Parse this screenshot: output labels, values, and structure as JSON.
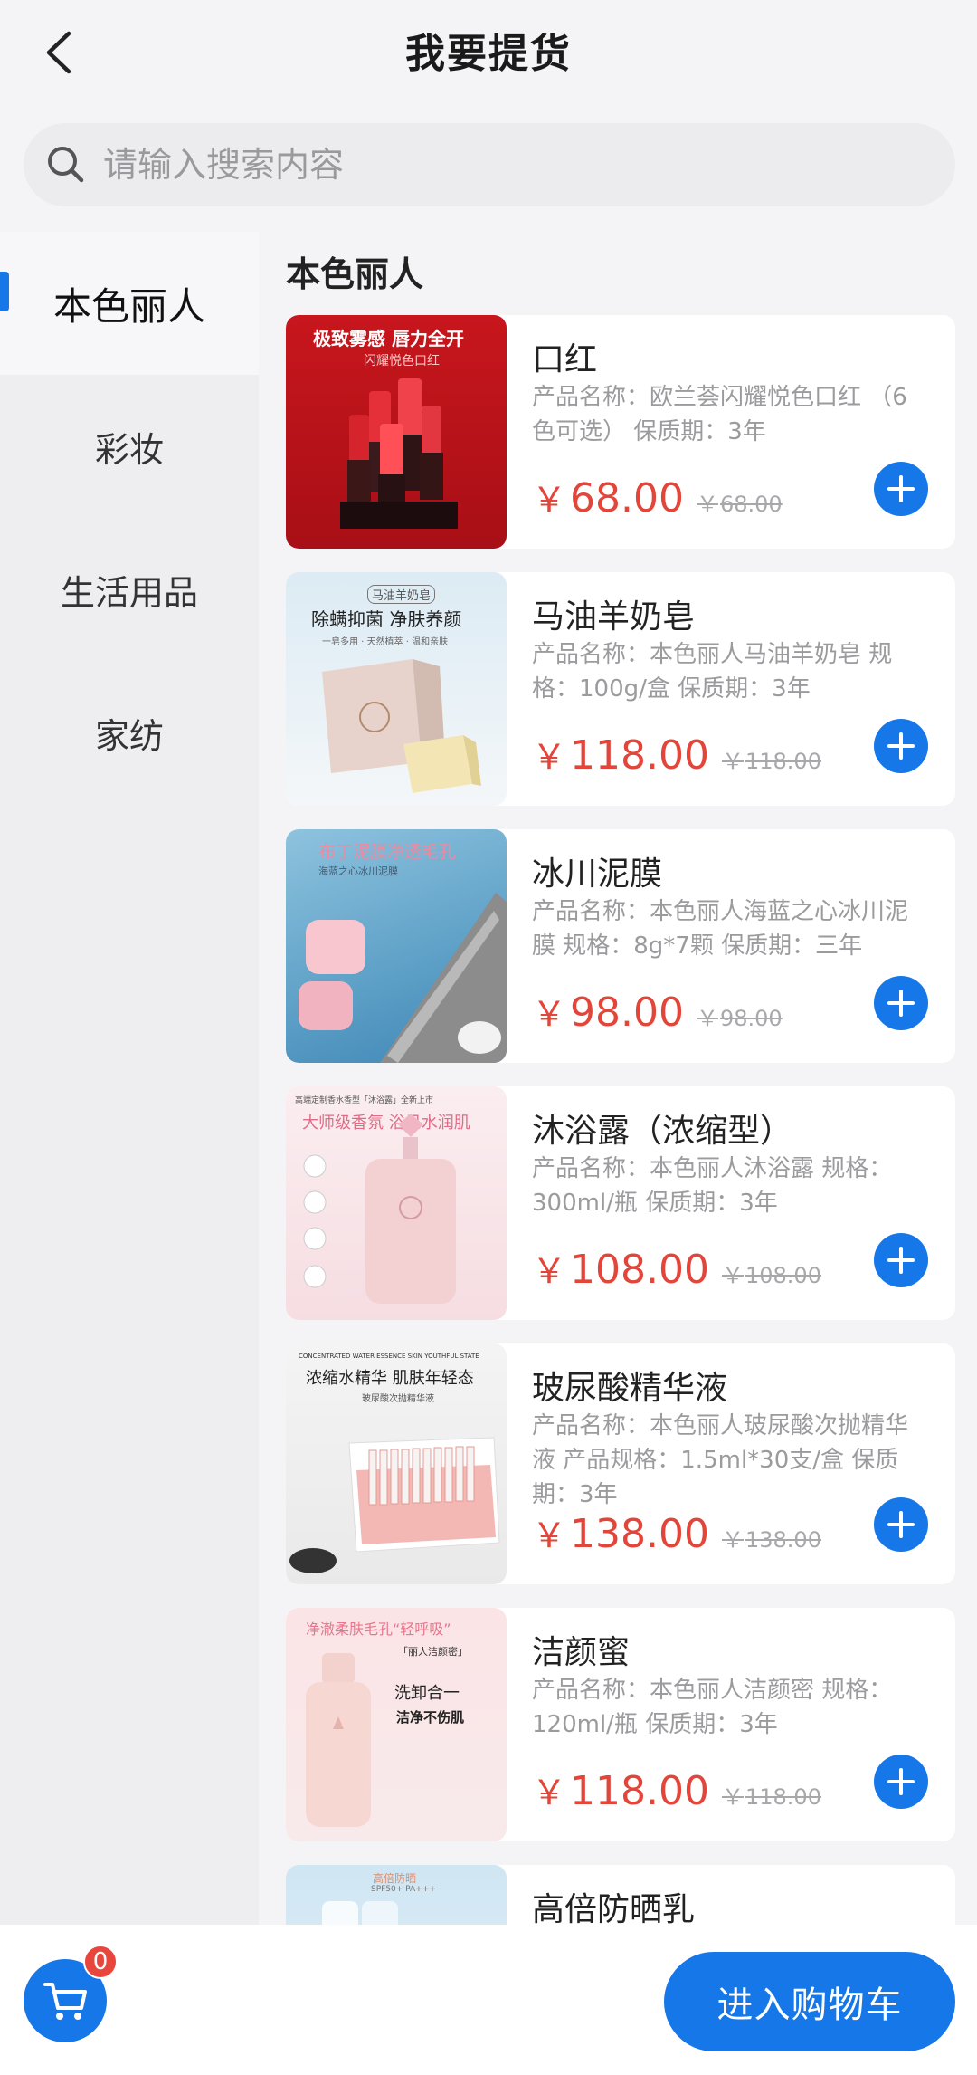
{
  "header": {
    "title": "我要提货"
  },
  "search": {
    "placeholder": "请输入搜索内容",
    "value": ""
  },
  "sidebar": {
    "items": [
      {
        "label": "本色丽人",
        "active": true
      },
      {
        "label": "彩妆",
        "active": false
      },
      {
        "label": "生活用品",
        "active": false
      },
      {
        "label": "家纺",
        "active": false
      }
    ]
  },
  "main": {
    "section_title": "本色丽人",
    "products": [
      {
        "name": "口红",
        "desc": "产品名称：欧兰荟闪耀悦色口红 （6色可选） 保质期：3年",
        "price": "68.00",
        "original_price": "68.00",
        "thumb": {
          "line1": "极致雾感 唇力全开",
          "line2": "闪耀悦色口红"
        }
      },
      {
        "name": "马油羊奶皂",
        "desc": "产品名称：本色丽人马油羊奶皂 规格：100g/盒 保质期：3年",
        "price": "118.00",
        "original_price": "118.00",
        "thumb": {
          "line1": "马油羊奶皂",
          "line2": "除螨抑菌 净肤养颜",
          "line3": "一皂多用 · 天然植萃 · 温和亲肤"
        }
      },
      {
        "name": "冰川泥膜",
        "desc": "产品名称：本色丽人海蓝之心冰川泥膜 规格：8g*7颗 保质期：三年",
        "price": "98.00",
        "original_price": "98.00",
        "thumb": {
          "line1": "布丁泥膜净透毛孔",
          "line2": "海蓝之心冰川泥膜"
        }
      },
      {
        "name": "沐浴露（浓缩型）",
        "desc": "产品名称：本色丽人沐浴露 规格：300ml/瓶 保质期：3年",
        "price": "108.00",
        "original_price": "108.00",
        "thumb": {
          "line1": "高端定制香水香型「沐浴露」全新上市",
          "line2": "大师级香氛 浴见水润肌"
        }
      },
      {
        "name": "玻尿酸精华液",
        "desc": "产品名称：本色丽人玻尿酸次抛精华液 产品规格：1.5ml*30支/盒 保质期：3年",
        "price": "138.00",
        "original_price": "138.00",
        "thumb": {
          "line1": "CONCENTRATED WATER ESSENCE SKIN YOUTHFUL STATE",
          "line2": "浓缩水精华 肌肤年轻态",
          "line3": "玻尿酸次抛精华液"
        }
      },
      {
        "name": "洁颜蜜",
        "desc": "产品名称：本色丽人洁颜密 规格：120ml/瓶 保质期：3年",
        "price": "118.00",
        "original_price": "118.00",
        "thumb": {
          "line1": "净澈柔肤毛孔“轻呼吸”",
          "line2": "「丽人洁颜密」",
          "line3": "洗卸合一",
          "line4": "洁净不伤肌"
        }
      },
      {
        "name": "高倍防晒乳",
        "desc": "",
        "price": "",
        "original_price": "",
        "thumb": {
          "line1": "高倍防晒",
          "line2": "SPF50+ PA+++"
        }
      }
    ]
  },
  "currency": "￥",
  "cart": {
    "count": "0",
    "checkout_label": "进入购物车"
  },
  "colors": {
    "accent": "#1677e8",
    "price": "#e2463a",
    "badge": "#e8453c"
  },
  "icons": {
    "back": "chevron-left-icon",
    "search": "search-icon",
    "add": "plus-circle-icon",
    "cart": "cart-icon"
  }
}
